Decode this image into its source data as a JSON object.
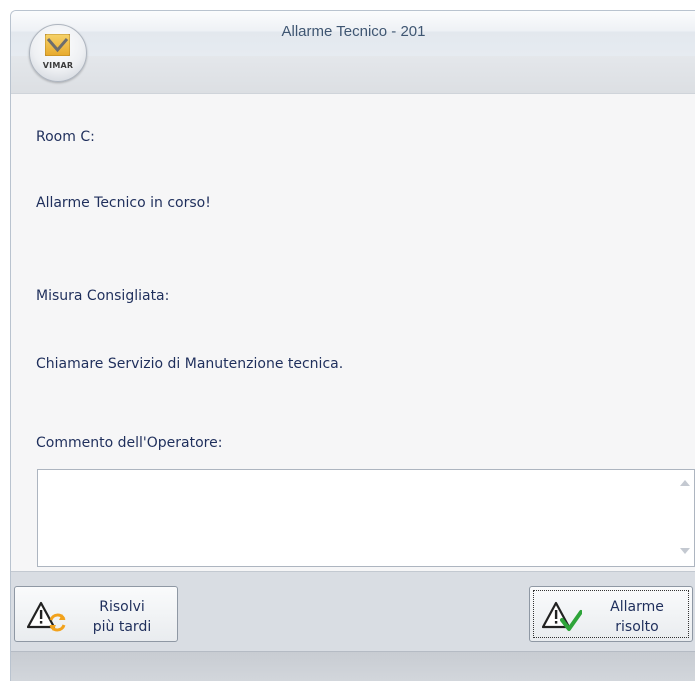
{
  "window": {
    "title": "Allarme Tecnico - 201",
    "logo_text": "VIMAR"
  },
  "content": {
    "room": "Room C:",
    "alarm_status": "Allarme Tecnico in corso!",
    "measure_label": "Misura Consigliata:",
    "measure_text": "Chiamare Servizio di Manutenzione tecnica.",
    "comment_label": "Commento dell'Operatore:",
    "comment_value": ""
  },
  "buttons": {
    "resolve_later": "Risolvi\npiù tardi",
    "alarm_resolved": "Allarme\nrisolto"
  },
  "colors": {
    "text": "#1f2f5c",
    "title": "#3f5672",
    "check_green": "#2ea43a",
    "arrow_orange": "#f2a21c"
  }
}
